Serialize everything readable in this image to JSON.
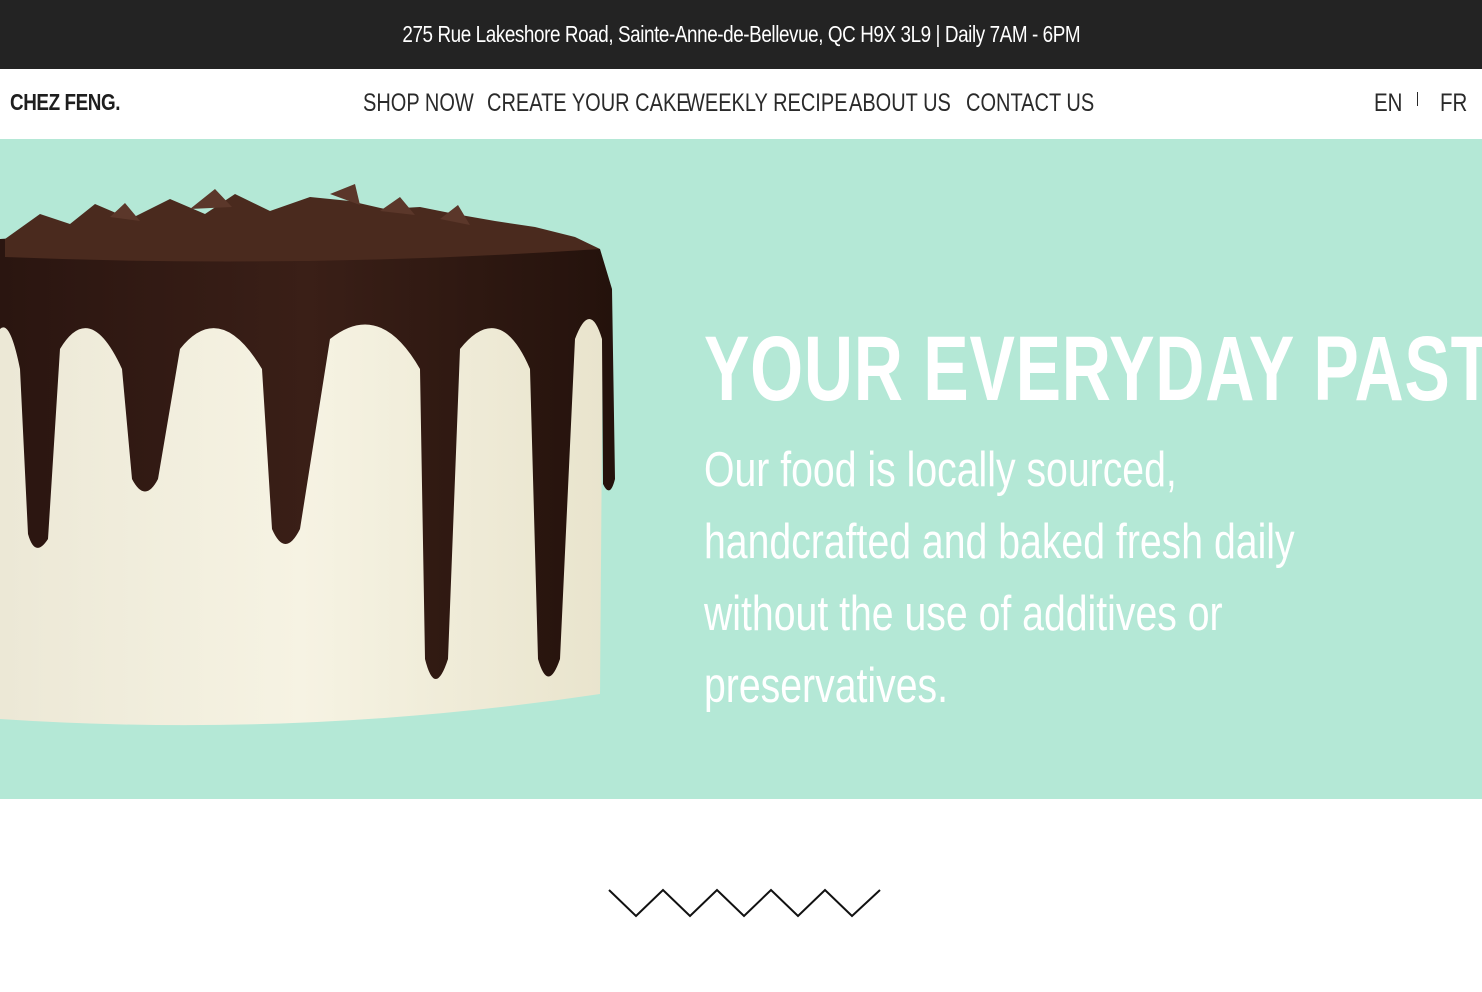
{
  "topbar": {
    "address": "275 Rue Lakeshore Road, Sainte-Anne-de-Bellevue, QC H9X 3L9  |  Daily 7AM - 6PM"
  },
  "nav": {
    "logo": "CHEZ FENG.",
    "items": [
      {
        "label": "SHOP NOW"
      },
      {
        "label": "CREATE YOUR CAKE"
      },
      {
        "label": "WEEKLY RECIPE"
      },
      {
        "label": "ABOUT US"
      },
      {
        "label": "CONTACT US"
      }
    ],
    "languages": [
      "EN",
      "FR"
    ]
  },
  "hero": {
    "title": "YOUR EVERYDAY PASTRY",
    "description": "Our food is locally sourced, handcrafted and baked fresh daily without the use of additives or preservatives.",
    "background": "#b4e8d6"
  },
  "colors": {
    "topbar_bg": "#232323",
    "text_dark": "#2a2a2a"
  }
}
